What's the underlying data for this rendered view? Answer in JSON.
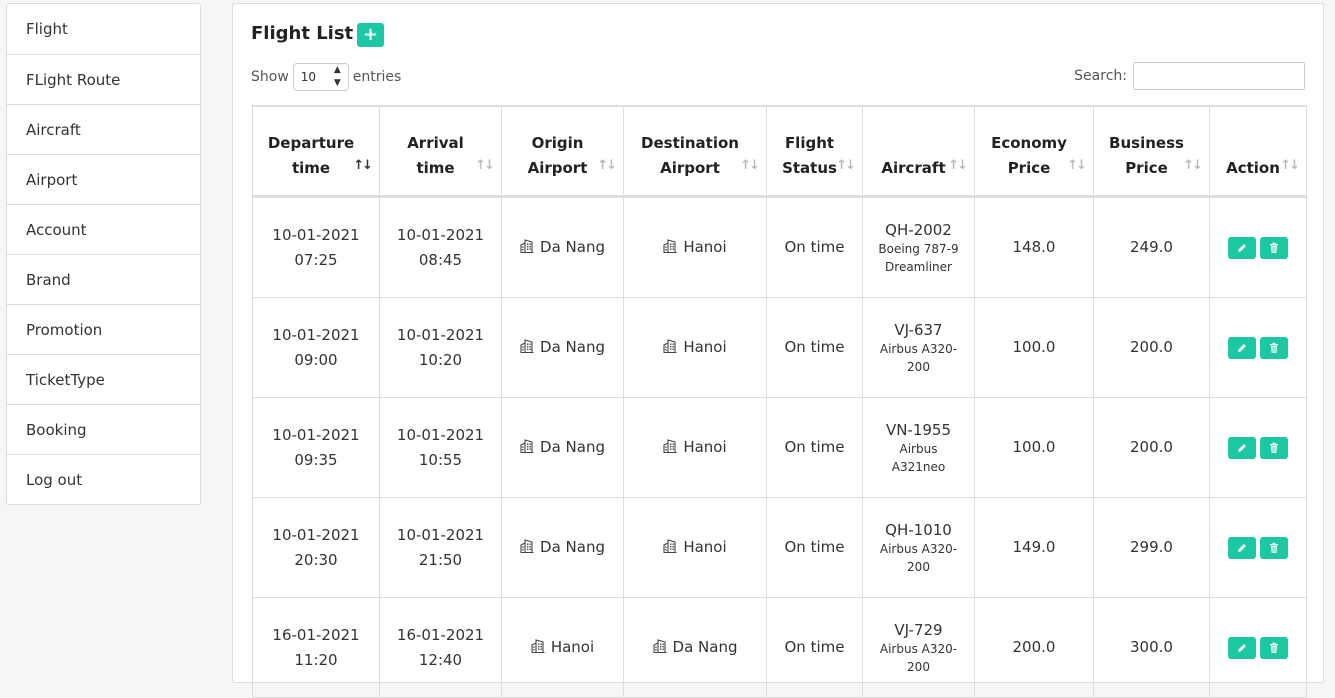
{
  "sidebar": {
    "items": [
      {
        "label": "Flight"
      },
      {
        "label": "FLight Route"
      },
      {
        "label": "Aircraft"
      },
      {
        "label": "Airport"
      },
      {
        "label": "Account"
      },
      {
        "label": "Brand"
      },
      {
        "label": "Promotion"
      },
      {
        "label": "TicketType"
      },
      {
        "label": "Booking"
      },
      {
        "label": "Log out"
      }
    ]
  },
  "main": {
    "title": "Flight List",
    "add_icon": "plus-icon",
    "show_label": "Show",
    "entries_value": "10",
    "entries_label": "entries",
    "search_label": "Search:",
    "search_value": ""
  },
  "table": {
    "headers": [
      {
        "line1": "Departure",
        "line2": "time"
      },
      {
        "line1": "Arrival",
        "line2": "time"
      },
      {
        "line1": "Origin",
        "line2": "Airport"
      },
      {
        "line1": "Destination",
        "line2": "Airport"
      },
      {
        "line1": "Flight",
        "line2": "Status"
      },
      {
        "line1": "",
        "line2": "Aircraft"
      },
      {
        "line1": "Economy",
        "line2": "Price"
      },
      {
        "line1": "Business",
        "line2": "Price"
      },
      {
        "line1": "",
        "line2": "Action"
      }
    ],
    "rows": [
      {
        "dep_date": "10-01-2021",
        "dep_time": "07:25",
        "arr_date": "10-01-2021",
        "arr_time": "08:45",
        "origin": "Da Nang",
        "destination": "Hanoi",
        "status": "On time",
        "aircraft_code": "QH-2002",
        "aircraft_model_1": "Boeing 787-9",
        "aircraft_model_2": "Dreamliner",
        "economy": "148.0",
        "business": "249.0"
      },
      {
        "dep_date": "10-01-2021",
        "dep_time": "09:00",
        "arr_date": "10-01-2021",
        "arr_time": "10:20",
        "origin": "Da Nang",
        "destination": "Hanoi",
        "status": "On time",
        "aircraft_code": "VJ-637",
        "aircraft_model_1": "Airbus A320-",
        "aircraft_model_2": "200",
        "economy": "100.0",
        "business": "200.0"
      },
      {
        "dep_date": "10-01-2021",
        "dep_time": "09:35",
        "arr_date": "10-01-2021",
        "arr_time": "10:55",
        "origin": "Da Nang",
        "destination": "Hanoi",
        "status": "On time",
        "aircraft_code": "VN-1955",
        "aircraft_model_1": "Airbus",
        "aircraft_model_2": "A321neo",
        "economy": "100.0",
        "business": "200.0"
      },
      {
        "dep_date": "10-01-2021",
        "dep_time": "20:30",
        "arr_date": "10-01-2021",
        "arr_time": "21:50",
        "origin": "Da Nang",
        "destination": "Hanoi",
        "status": "On time",
        "aircraft_code": "QH-1010",
        "aircraft_model_1": "Airbus A320-",
        "aircraft_model_2": "200",
        "economy": "149.0",
        "business": "299.0"
      },
      {
        "dep_date": "16-01-2021",
        "dep_time": "11:20",
        "arr_date": "16-01-2021",
        "arr_time": "12:40",
        "origin": "Hanoi",
        "destination": "Da Nang",
        "status": "On time",
        "aircraft_code": "VJ-729",
        "aircraft_model_1": "Airbus A320-",
        "aircraft_model_2": "200",
        "economy": "200.0",
        "business": "300.0"
      }
    ]
  },
  "colors": {
    "accent": "#1cc8a4"
  }
}
